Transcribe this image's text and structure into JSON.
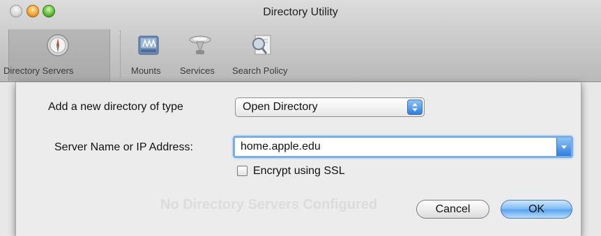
{
  "window": {
    "title": "Directory Utility"
  },
  "toolbar": {
    "items": [
      {
        "label": "Directory Servers",
        "selected": true,
        "icon": "compass-icon"
      },
      {
        "label": "Mounts",
        "icon": "mounts-icon"
      },
      {
        "label": "Services",
        "icon": "services-icon"
      },
      {
        "label": "Search Policy",
        "icon": "search-policy-icon"
      }
    ]
  },
  "sheet": {
    "type_label": "Add a new directory of type",
    "type_value": "Open Directory",
    "server_label": "Server Name or IP Address:",
    "server_value": "home.apple.edu",
    "ssl_label": "Encrypt using SSL",
    "ssl_checked": false,
    "background_message": "No Directory Servers Configured",
    "cancel_label": "Cancel",
    "ok_label": "OK"
  },
  "colors": {
    "accent": "#5aa4ef",
    "focus_ring": "#7aaee6"
  }
}
